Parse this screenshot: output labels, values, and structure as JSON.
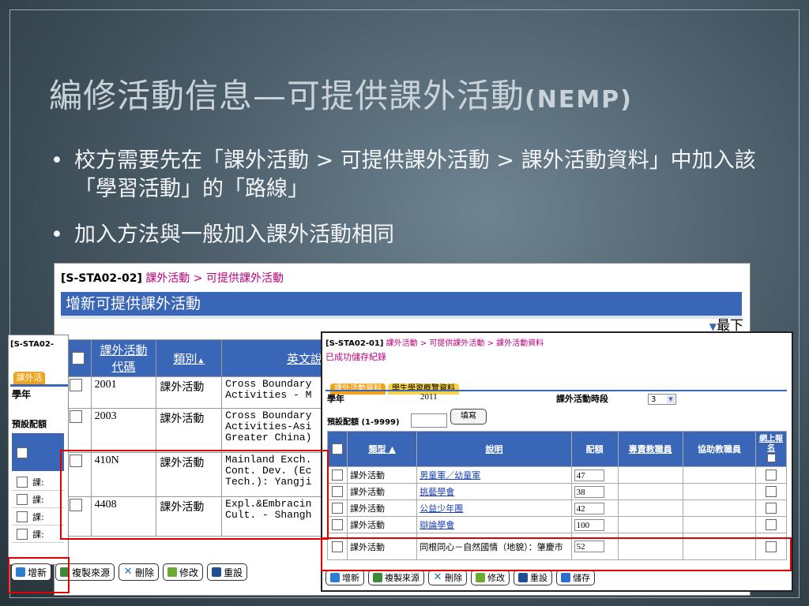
{
  "slide": {
    "title": "編修活動信息—可提供課外活動",
    "title_en": "(NEMP)",
    "bullets": [
      "校方需要先在「課外活動 > 可提供課外活動 > 課外活動資料」中加入該「學習活動」的「路線」",
      "加入方法與一般加入課外活動相同"
    ]
  },
  "back_window": {
    "code": "[S-STA02-02]",
    "breadcrumb": "課外活動 > 可提供課外活動",
    "header": "增新可提供課外活動",
    "top_link": "最下",
    "columns": [
      "課外活動代碼",
      "類別",
      "英文說"
    ],
    "rows": [
      {
        "code": "2001",
        "category": "課外活動",
        "english": "Cross Boundary\nActivities - M"
      },
      {
        "code": "2003",
        "category": "課外活動",
        "english": "Cross Boundary\nActivities-Asi\nGreater China)"
      },
      {
        "code": "410N",
        "category": "課外活動",
        "english": "Mainland Exch.\nCont. Dev. (Ec\nTech.): Yangji"
      },
      {
        "code": "4408",
        "category": "課外活動",
        "english": "Expl.&Embracin\nCult. - Shangh"
      }
    ],
    "partial_row_value": "100"
  },
  "left_window": {
    "code": "[S-STA02-",
    "tab": "課外活動",
    "year_label": "學年",
    "preset_label": "預設配額",
    "rows": [
      "課:",
      "課:",
      "課:",
      "課:"
    ]
  },
  "front_window": {
    "code": "[S-STA02-01]",
    "breadcrumb": "課外活動 > 可提供課外活動 > 課外活動資料",
    "saved_msg": "已成功儲存紀錄",
    "tabs": [
      "課外活動資料",
      "學生學習概覽資料"
    ],
    "year_label": "學年",
    "year_value": "2011",
    "period_label": "課外活動時段",
    "period_value": "3",
    "preset_label": "預設配額 (1-9999)",
    "fill_button": "填寫",
    "columns": [
      "類型",
      "說明",
      "配額",
      "專責教職員",
      "協助教職員",
      "網上報名"
    ],
    "rows": [
      {
        "type": "課外活動",
        "desc": "男童軍／幼童軍",
        "quota": "47"
      },
      {
        "type": "課外活動",
        "desc": "挑藝學會",
        "quota": "38"
      },
      {
        "type": "課外活動",
        "desc": "公益少年團",
        "quota": "42"
      },
      {
        "type": "課外活動",
        "desc": "辯論學會",
        "quota": "100"
      },
      {
        "type": "課外活動",
        "desc": "同根同心－自然國情（地貌）：肇慶市",
        "quota": "52"
      }
    ]
  },
  "toolbar": {
    "add": "增新",
    "copy_source": "複製來源",
    "delete": "刪除",
    "edit": "修改",
    "reset": "重設",
    "save": "儲存"
  },
  "colors": {
    "header_blue": "#3a66b8",
    "tab_orange": "#f2a21b",
    "highlight_red": "#e00000"
  }
}
